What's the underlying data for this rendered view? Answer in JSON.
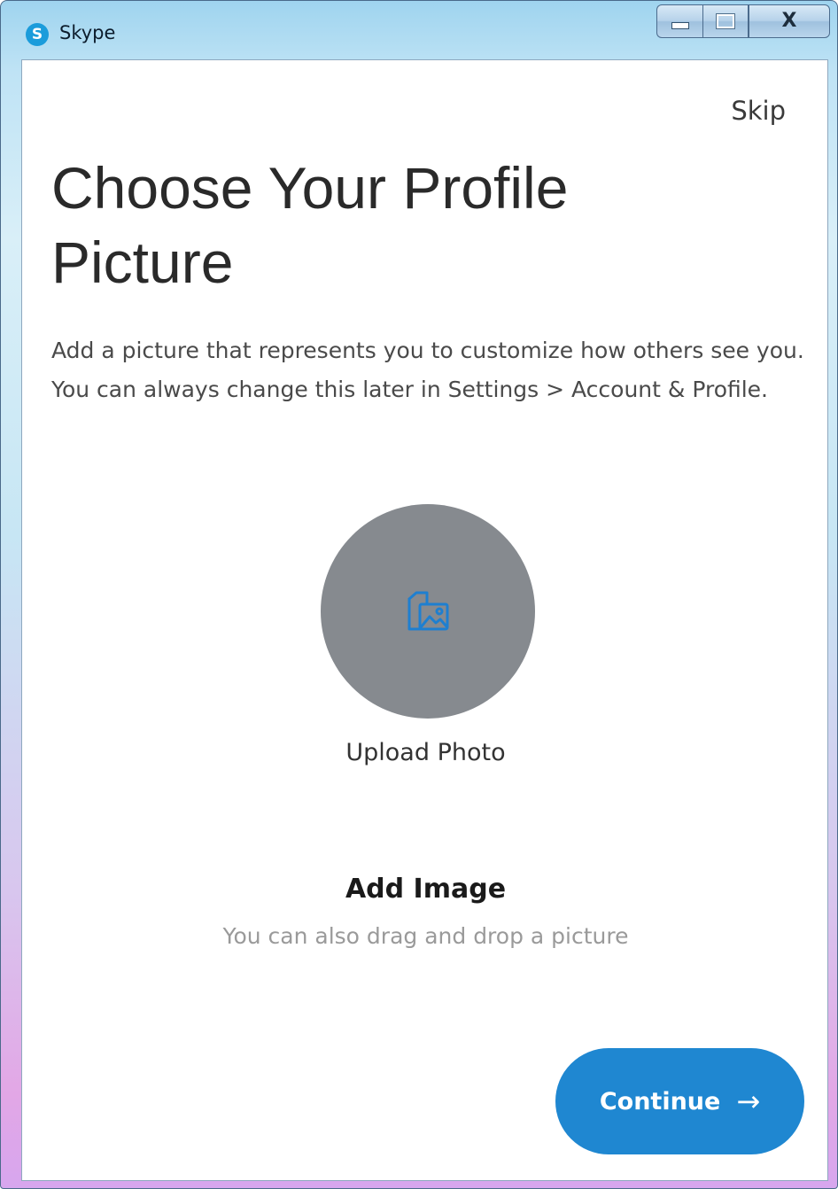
{
  "window": {
    "title": "Skype",
    "app_icon_letter": "S",
    "controls": {
      "minimize": "minimize",
      "maximize": "maximize",
      "close": "X"
    }
  },
  "onboarding": {
    "skip_label": "Skip",
    "heading_line1": "Choose Your Profile",
    "heading_line2": "Picture",
    "description": "Add a picture that represents you to customize how others see you. You can always change this later in Settings > Account & Profile.",
    "upload_icon": "image-upload-icon",
    "upload_label": "Upload Photo",
    "add_image_label": "Add Image",
    "drag_hint": "You can also drag and drop a picture",
    "continue_label": "Continue",
    "continue_arrow": "→"
  },
  "colors": {
    "accent": "#1f87d1",
    "avatar_bg": "#868a8f",
    "icon_blue": "#1e7fd0"
  }
}
